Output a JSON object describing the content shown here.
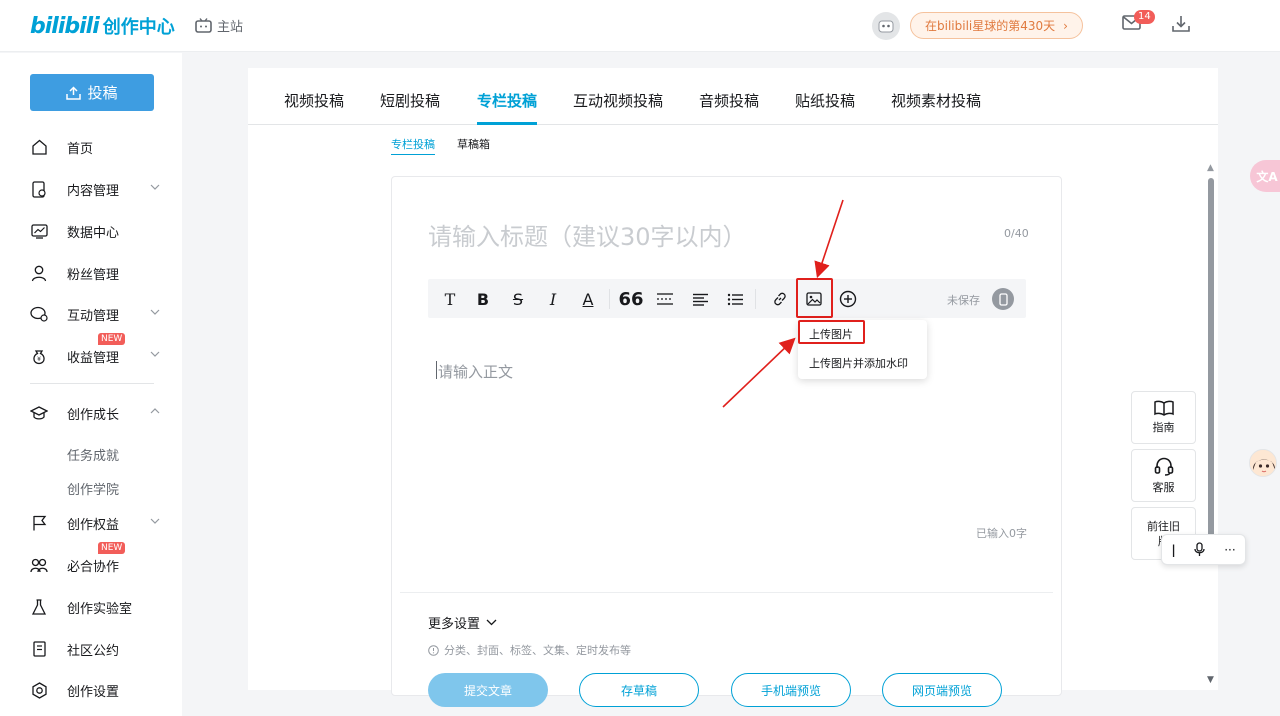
{
  "header": {
    "logo_text": "bilibili",
    "logo_suffix": "创作中心",
    "main_site": "主站",
    "planet_text": "在bilibili星球的第430天",
    "mail_count": "14"
  },
  "sidebar": {
    "upload_label": "投稿",
    "items": [
      {
        "label": "首页"
      },
      {
        "label": "内容管理"
      },
      {
        "label": "数据中心"
      },
      {
        "label": "粉丝管理"
      },
      {
        "label": "互动管理"
      },
      {
        "label": "收益管理",
        "badge": "NEW"
      },
      {
        "label": "创作成长"
      },
      {
        "label": "创作权益"
      },
      {
        "label": "必合协作",
        "badge": "NEW"
      },
      {
        "label": "创作实验室"
      },
      {
        "label": "社区公约"
      },
      {
        "label": "创作设置"
      }
    ],
    "sub_items": [
      "任务成就",
      "创作学院"
    ]
  },
  "tabs": [
    "视频投稿",
    "短剧投稿",
    "专栏投稿",
    "互动视频投稿",
    "音频投稿",
    "贴纸投稿",
    "视频素材投稿"
  ],
  "active_tab": "专栏投稿",
  "subtabs": [
    "专栏投稿",
    "草稿箱"
  ],
  "editor": {
    "title_placeholder": "请输入标题（建议30字以内）",
    "title_count": "0/40",
    "unsaved": "未保存",
    "body_placeholder": "请输入正文",
    "word_count": "已输入0字",
    "image_menu": [
      "上传图片",
      "上传图片并添加水印"
    ],
    "more_settings": "更多设置",
    "more_settings_desc": "分类、封面、标签、文集、定时发布等",
    "buttons": [
      "提交文章",
      "存草稿",
      "手机端预览",
      "网页端预览"
    ]
  },
  "float": {
    "guide": "指南",
    "service": "客服",
    "old_version": "前往旧版",
    "translate": "文A"
  },
  "colors": {
    "accent": "#00a1d6",
    "highlight": "#e0201c",
    "badge": "#f25d59"
  }
}
